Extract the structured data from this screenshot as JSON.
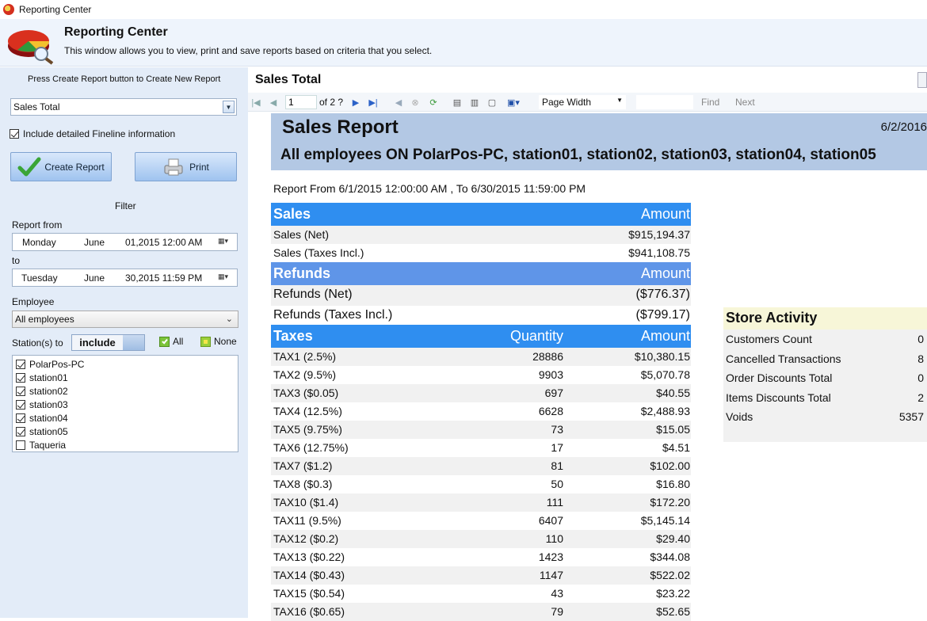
{
  "window": {
    "title": "Reporting Center"
  },
  "header": {
    "title": "Reporting Center",
    "subtitle": "This window allows you to view, print and save reports based on criteria that you select."
  },
  "left": {
    "hint": "Press Create Report button to Create New Report",
    "report_select": "Sales Total",
    "include_detailed": "Include detailed Fineline information",
    "create_label": "Create Report",
    "print_label": "Print",
    "filter_label": "Filter",
    "report_from_label": "Report from",
    "from": {
      "day": "Monday",
      "month": "June",
      "datetime": "01,2015 12:00 AM"
    },
    "to_label": "to",
    "to": {
      "day": "Tuesday",
      "month": "June",
      "datetime": "30,2015 11:59 PM"
    },
    "employee_label": "Employee",
    "employee_value": "All employees",
    "stations_label": "Station(s) to",
    "include_toggle": "include",
    "all_label": "All",
    "none_label": "None",
    "stations": [
      {
        "name": "PolarPos-PC",
        "checked": true
      },
      {
        "name": "station01",
        "checked": true
      },
      {
        "name": "station02",
        "checked": true
      },
      {
        "name": "station03",
        "checked": true
      },
      {
        "name": "station04",
        "checked": true
      },
      {
        "name": "station05",
        "checked": true
      },
      {
        "name": "Taqueria",
        "checked": false
      }
    ]
  },
  "viewer": {
    "title": "Sales Total",
    "page_current": "1",
    "page_of": "of  2 ?",
    "zoom": "Page Width",
    "find": "Find",
    "next": "Next"
  },
  "report": {
    "title": "Sales Report",
    "date": "6/2/2016",
    "employees_line": "All employees ON PolarPos-PC, station01, station02, station03, station04, station05",
    "range": "Report From 6/1/2015 12:00:00 AM , To 6/30/2015 11:59:00 PM",
    "sales_header": "Sales",
    "amount_header": "Amount",
    "quantity_header": "Quantity",
    "sales": [
      {
        "name": "Sales (Net)",
        "amount": "$915,194.37"
      },
      {
        "name": "Sales (Taxes Incl.)",
        "amount": "$941,108.75"
      }
    ],
    "refunds_header": "Refunds",
    "refunds": [
      {
        "name": "Refunds (Net)",
        "amount": "($776.37)"
      },
      {
        "name": "Refunds (Taxes Incl.)",
        "amount": "($799.17)"
      }
    ],
    "taxes_header": "Taxes",
    "taxes": [
      {
        "name": "TAX1 (2.5%)",
        "qty": "28886",
        "amount": "$10,380.15"
      },
      {
        "name": "TAX2 (9.5%)",
        "qty": "9903",
        "amount": "$5,070.78"
      },
      {
        "name": "TAX3 ($0.05)",
        "qty": "697",
        "amount": "$40.55"
      },
      {
        "name": "TAX4 (12.5%)",
        "qty": "6628",
        "amount": "$2,488.93"
      },
      {
        "name": "TAX5 (9.75%)",
        "qty": "73",
        "amount": "$15.05"
      },
      {
        "name": "TAX6 (12.75%)",
        "qty": "17",
        "amount": "$4.51"
      },
      {
        "name": "TAX7 ($1.2)",
        "qty": "81",
        "amount": "$102.00"
      },
      {
        "name": "TAX8 ($0.3)",
        "qty": "50",
        "amount": "$16.80"
      },
      {
        "name": "TAX10 ($1.4)",
        "qty": "111",
        "amount": "$172.20"
      },
      {
        "name": "TAX11 (9.5%)",
        "qty": "6407",
        "amount": "$5,145.14"
      },
      {
        "name": "TAX12 ($0.2)",
        "qty": "110",
        "amount": "$29.40"
      },
      {
        "name": "TAX13 ($0.22)",
        "qty": "1423",
        "amount": "$344.08"
      },
      {
        "name": "TAX14 ($0.43)",
        "qty": "1147",
        "amount": "$522.02"
      },
      {
        "name": "TAX15 ($0.54)",
        "qty": "43",
        "amount": "$23.22"
      },
      {
        "name": "TAX16 ($0.65)",
        "qty": "79",
        "amount": "$52.65"
      }
    ],
    "store_activity": {
      "title": "Store Activity",
      "rows": [
        {
          "name": "Customers Count",
          "value": "0"
        },
        {
          "name": "Cancelled Transactions",
          "value": "8"
        },
        {
          "name": "Order Discounts Total",
          "value": "0"
        },
        {
          "name": "Items Discounts Total",
          "value": "2"
        },
        {
          "name": "Voids",
          "value": "5357"
        }
      ]
    }
  },
  "colors": {
    "section_blue": "#2f8ef0",
    "refunds_blue": "#5f95e8",
    "report_header": "#b3c8e4",
    "left_panel": "#e3ecf8",
    "store_header": "#f7f6d8"
  }
}
